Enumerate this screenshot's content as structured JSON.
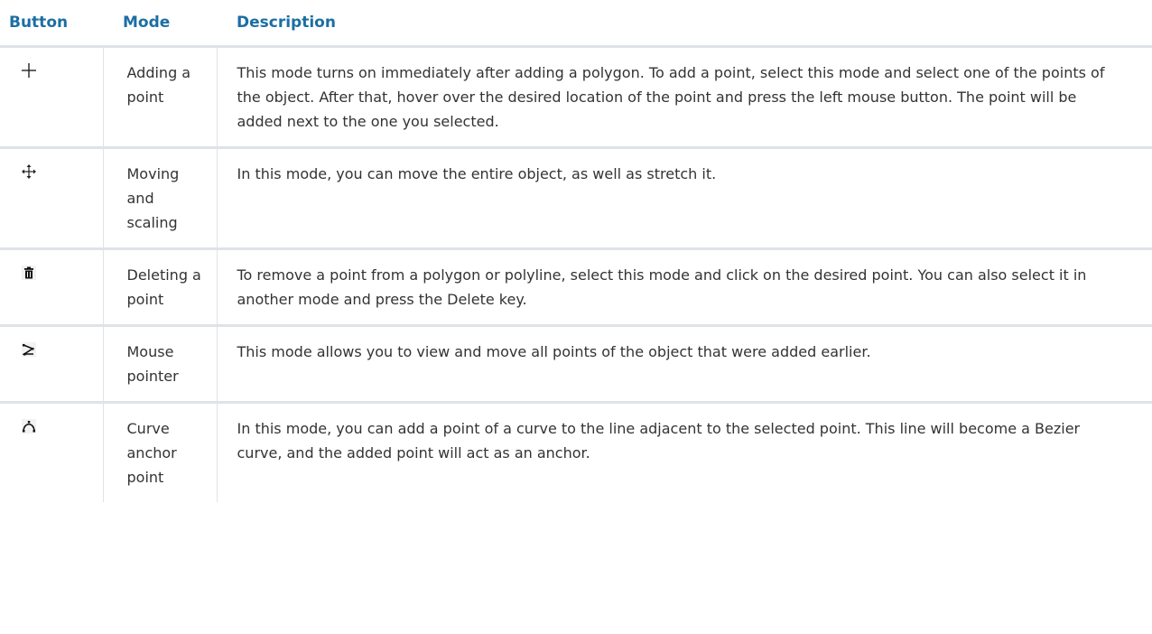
{
  "table": {
    "headers": {
      "button": "Button",
      "mode": "Mode",
      "description": "Description"
    },
    "rows": [
      {
        "icon": "plus-icon",
        "mode": "Adding a point",
        "description": "This mode turns on immediately after adding a polygon. To add a point, select this mode and select one of the points of the object. After that, hover over the desired location of the point and press the left mouse button. The point will be added next to the one you selected."
      },
      {
        "icon": "move-arrows-icon",
        "mode": "Moving and scaling",
        "description": "In this mode, you can move the entire object, as well as stretch it."
      },
      {
        "icon": "trash-icon",
        "mode": "Deleting a point",
        "description": "To remove a point from a polygon or polyline, select this mode and click on the desired point. You can also select it in another mode and press the Delete key."
      },
      {
        "icon": "polyline-pointer-icon",
        "mode": "Mouse pointer",
        "description": "This mode allows you to view and move all points of the object that were added earlier."
      },
      {
        "icon": "curve-anchor-icon",
        "mode": "Curve anchor point",
        "description": "In this mode, you can add a point of a curve to the line adjacent to the selected point. This line will become a Bezier curve, and the added point will act as an anchor."
      }
    ]
  }
}
